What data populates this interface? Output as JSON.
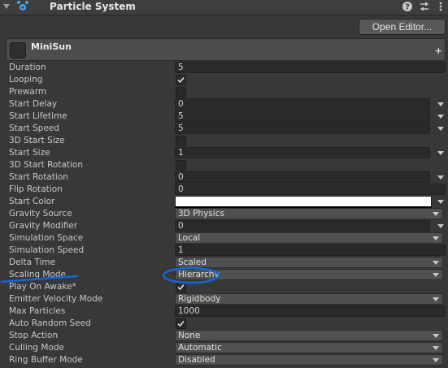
{
  "header": {
    "title": "Particle System",
    "icons": [
      "particle-system-icon",
      "help-icon",
      "preset-icon",
      "kebab-menu-icon"
    ]
  },
  "toolbar": {
    "open_editor_label": "Open Editor..."
  },
  "module": {
    "title": "MiniSun",
    "plus": "+"
  },
  "properties": [
    {
      "label": "Duration",
      "type": "field",
      "value": "5"
    },
    {
      "label": "Looping",
      "type": "checkbox",
      "checked": true
    },
    {
      "label": "Prewarm",
      "type": "checkbox",
      "checked": false
    },
    {
      "label": "Start Delay",
      "type": "field-caret",
      "value": "0"
    },
    {
      "label": "Start Lifetime",
      "type": "field-caret",
      "value": "5"
    },
    {
      "label": "Start Speed",
      "type": "field-caret",
      "value": "5"
    },
    {
      "label": "3D Start Size",
      "type": "checkbox",
      "checked": false
    },
    {
      "label": "Start Size",
      "type": "field-caret",
      "value": "1"
    },
    {
      "label": "3D Start Rotation",
      "type": "checkbox",
      "checked": false
    },
    {
      "label": "Start Rotation",
      "type": "field-caret",
      "value": "0"
    },
    {
      "label": "Flip Rotation",
      "type": "field",
      "value": "0"
    },
    {
      "label": "Start Color",
      "type": "color",
      "color": "#ffffff"
    },
    {
      "label": "Gravity Source",
      "type": "popup",
      "value": "3D Physics"
    },
    {
      "label": "Gravity Modifier",
      "type": "field-caret",
      "value": "0"
    },
    {
      "label": "Simulation Space",
      "type": "popup",
      "value": "Local"
    },
    {
      "label": "Simulation Speed",
      "type": "field",
      "value": "1"
    },
    {
      "label": "Delta Time",
      "type": "popup",
      "value": "Scaled"
    },
    {
      "label": "Scaling Mode",
      "type": "popup",
      "value": "Hierarchy"
    },
    {
      "label": "Play On Awake*",
      "type": "checkbox",
      "checked": true
    },
    {
      "label": "Emitter Velocity Mode",
      "type": "popup",
      "value": "Rigidbody"
    },
    {
      "label": "Max Particles",
      "type": "field",
      "value": "1000"
    },
    {
      "label": "Auto Random Seed",
      "type": "checkbox",
      "checked": true
    },
    {
      "label": "Stop Action",
      "type": "popup",
      "value": "None"
    },
    {
      "label": "Culling Mode",
      "type": "popup",
      "value": "Automatic"
    },
    {
      "label": "Ring Buffer Mode",
      "type": "popup",
      "value": "Disabled"
    }
  ],
  "colors": {
    "annotation": "#1565d8",
    "background": "#383838"
  }
}
